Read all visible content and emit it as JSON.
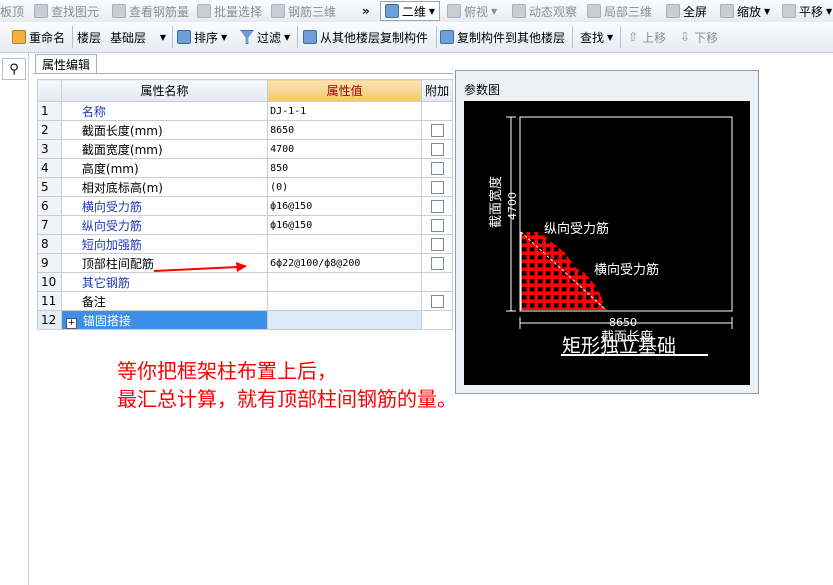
{
  "toolbar1": {
    "items": [
      {
        "label": "板顶",
        "icon": "beam-top-icon"
      },
      {
        "label": "查找图元",
        "icon": "find-element-icon"
      },
      {
        "label": "查看钢筋量",
        "icon": "rebar-quantity-icon"
      },
      {
        "label": "批量选择",
        "icon": "batch-select-icon"
      },
      {
        "label": "钢筋三维",
        "icon": "rebar-3d-icon"
      },
      {
        "label": "二维",
        "icon": "2d-view-icon"
      },
      {
        "label": "俯视",
        "icon": "top-view-icon"
      },
      {
        "label": "动态观察",
        "icon": "orbit-icon"
      },
      {
        "label": "局部三维",
        "icon": "local-3d-icon"
      },
      {
        "label": "全屏",
        "icon": "fullscreen-icon"
      },
      {
        "label": "缩放",
        "icon": "zoom-icon"
      },
      {
        "label": "平移",
        "icon": "pan-icon"
      }
    ],
    "overflow": "»"
  },
  "toolbar2": {
    "rename": "重命名",
    "floor_label": "楼层",
    "floor_value": "基础层",
    "sort": "排序",
    "filter": "过滤",
    "copy_from": "从其他楼层复制构件",
    "copy_to": "复制构件到其他楼层",
    "find": "查找",
    "move_up": "上移",
    "move_down": "下移"
  },
  "panel": {
    "tab": "属性编辑",
    "headers": {
      "name": "属性名称",
      "value": "属性值",
      "extra": "附加"
    },
    "rows": [
      {
        "no": "1",
        "name": "名称",
        "value": "DJ-1-1",
        "blue": true,
        "check": false
      },
      {
        "no": "2",
        "name": "截面长度(mm)",
        "value": "8650",
        "blue": false,
        "check": true
      },
      {
        "no": "3",
        "name": "截面宽度(mm)",
        "value": "4700",
        "blue": false,
        "check": true
      },
      {
        "no": "4",
        "name": "高度(mm)",
        "value": "850",
        "blue": false,
        "check": true
      },
      {
        "no": "5",
        "name": "相对底标高(m)",
        "value": "(0)",
        "blue": false,
        "check": true
      },
      {
        "no": "6",
        "name": "横向受力筋",
        "value": "ф16@150",
        "blue": true,
        "check": true
      },
      {
        "no": "7",
        "name": "纵向受力筋",
        "value": "ф16@150",
        "blue": true,
        "check": true
      },
      {
        "no": "8",
        "name": "短向加强筋",
        "value": "",
        "blue": true,
        "check": true
      },
      {
        "no": "9",
        "name": "顶部柱间配筋",
        "value": "6ф22@100/ф8@200",
        "blue": false,
        "check": true
      },
      {
        "no": "10",
        "name": "其它钢筋",
        "value": "",
        "blue": true,
        "check": false
      },
      {
        "no": "11",
        "name": "备注",
        "value": "",
        "blue": false,
        "check": true
      },
      {
        "no": "12",
        "name": "锚固搭接",
        "value": "",
        "blue": false,
        "check": false
      }
    ]
  },
  "param_dialog": {
    "title": "参数图",
    "width_label": "截面宽度",
    "width_value": "4700",
    "length_label": "截面长度",
    "length_value": "8650",
    "long_rebar_label": "纵向受力筋",
    "trans_rebar_label": "横向受力筋",
    "caption": "矩形独立基础"
  },
  "annotation": {
    "line1": "等你把框架柱布置上后，",
    "line2": "最汇总计算，就有顶部柱间钢筋的量。"
  },
  "colors": {
    "accent_red": "#ff0000",
    "link_blue": "#1d38b8",
    "header_value_bg": "#f6c66d",
    "selected_row": "#3d8ee6"
  }
}
